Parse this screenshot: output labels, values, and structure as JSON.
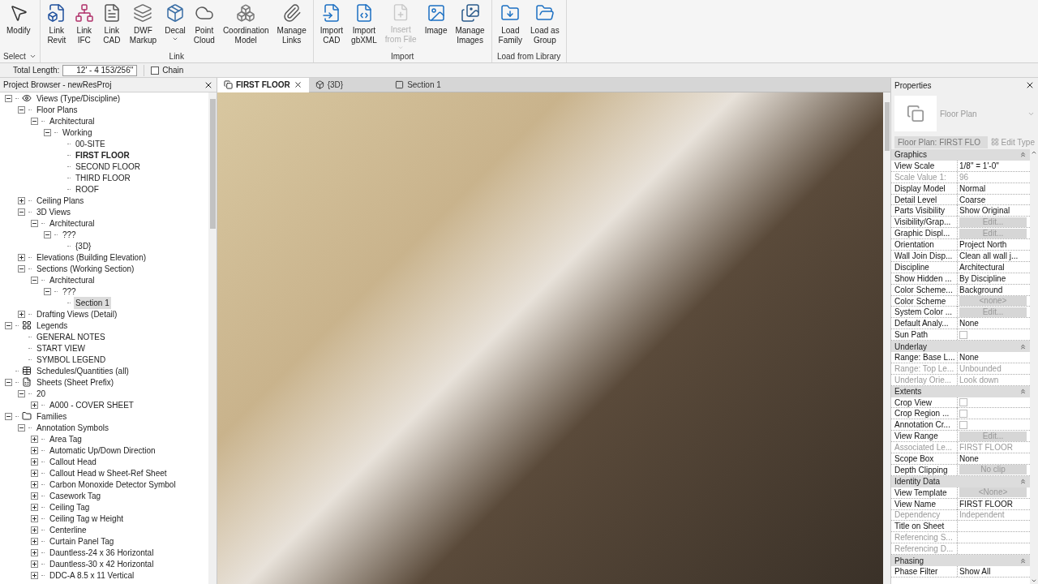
{
  "ribbon": {
    "groups": [
      {
        "label": "Select",
        "dropdown": true,
        "buttons": [
          {
            "lines": [
              "Modify"
            ],
            "disabled": false,
            "dropdown": false
          }
        ]
      },
      {
        "label": "Link",
        "dropdown": false,
        "buttons": [
          {
            "lines": [
              "Link",
              "Revit"
            ],
            "disabled": false,
            "dropdown": false
          },
          {
            "lines": [
              "Link",
              "IFC"
            ],
            "disabled": false,
            "dropdown": false
          },
          {
            "lines": [
              "Link",
              "CAD"
            ],
            "disabled": false,
            "dropdown": false
          },
          {
            "lines": [
              "DWF",
              "Markup"
            ],
            "disabled": false,
            "dropdown": false
          },
          {
            "lines": [
              "Decal"
            ],
            "disabled": false,
            "dropdown": true
          },
          {
            "lines": [
              "Point",
              "Cloud"
            ],
            "disabled": false,
            "dropdown": false
          },
          {
            "lines": [
              "Coordination",
              "Model"
            ],
            "disabled": false,
            "dropdown": false
          },
          {
            "lines": [
              "Manage",
              "Links"
            ],
            "disabled": false,
            "dropdown": false
          }
        ]
      },
      {
        "label": "Import",
        "dropdown": false,
        "buttons": [
          {
            "lines": [
              "Import",
              "CAD"
            ],
            "disabled": false,
            "dropdown": false
          },
          {
            "lines": [
              "Import",
              "gbXML"
            ],
            "disabled": false,
            "dropdown": false
          },
          {
            "lines": [
              "Insert",
              "from File"
            ],
            "disabled": true,
            "dropdown": true
          },
          {
            "lines": [
              "Image"
            ],
            "disabled": false,
            "dropdown": false
          },
          {
            "lines": [
              "Manage",
              "Images"
            ],
            "disabled": false,
            "dropdown": false
          }
        ]
      },
      {
        "label": "Load from Library",
        "dropdown": false,
        "buttons": [
          {
            "lines": [
              "Load",
              "Family"
            ],
            "disabled": false,
            "dropdown": false
          },
          {
            "lines": [
              "Load as",
              "Group"
            ],
            "disabled": false,
            "dropdown": false
          }
        ]
      }
    ]
  },
  "options_bar": {
    "length_label": "Total Length:",
    "length_value": "12' - 4 153/256\"",
    "chain": {
      "label": "Chain",
      "checked": false
    }
  },
  "project_browser": {
    "title": "Project Browser - newResProj",
    "tree": [
      {
        "label": "Views (Type/Discipline)",
        "kind": "views",
        "expanded": true,
        "selected": false,
        "children": [
          {
            "label": "Floor Plans",
            "expanded": true,
            "selected": false,
            "children": [
              {
                "label": "Architectural",
                "expanded": true,
                "selected": false,
                "children": [
                  {
                    "label": "Working",
                    "expanded": true,
                    "selected": false,
                    "children": [
                      {
                        "label": "00-SITE",
                        "selected": false
                      },
                      {
                        "label": "FIRST FLOOR",
                        "selected": false,
                        "bold": true
                      },
                      {
                        "label": "SECOND FLOOR",
                        "selected": false
                      },
                      {
                        "label": "THIRD FLOOR",
                        "selected": false
                      },
                      {
                        "label": "ROOF",
                        "selected": false
                      }
                    ]
                  }
                ]
              }
            ]
          },
          {
            "label": "Ceiling Plans",
            "expanded": false,
            "selected": false
          },
          {
            "label": "3D Views",
            "expanded": true,
            "selected": false,
            "children": [
              {
                "label": "Architectural",
                "expanded": true,
                "selected": false,
                "children": [
                  {
                    "label": "???",
                    "expanded": true,
                    "selected": false,
                    "children": [
                      {
                        "label": "{3D}",
                        "selected": false
                      }
                    ]
                  }
                ]
              }
            ]
          },
          {
            "label": "Elevations (Building Elevation)",
            "expanded": false,
            "selected": false
          },
          {
            "label": "Sections (Working Section)",
            "expanded": true,
            "selected": false,
            "children": [
              {
                "label": "Architectural",
                "expanded": true,
                "selected": false,
                "children": [
                  {
                    "label": "???",
                    "expanded": true,
                    "selected": false,
                    "children": [
                      {
                        "label": "Section 1",
                        "selected": true
                      }
                    ]
                  }
                ]
              }
            ]
          },
          {
            "label": "Drafting Views (Detail)",
            "expanded": false,
            "selected": false
          }
        ]
      },
      {
        "label": "Legends",
        "kind": "legends",
        "expanded": true,
        "selected": false,
        "children": [
          {
            "label": "GENERAL NOTES",
            "selected": false
          },
          {
            "label": "START VIEW",
            "selected": false
          },
          {
            "label": "SYMBOL LEGEND",
            "selected": false
          }
        ]
      },
      {
        "label": "Schedules/Quantities (all)",
        "kind": "schedules",
        "selected": false
      },
      {
        "label": "Sheets (Sheet Prefix)",
        "kind": "sheets",
        "expanded": true,
        "selected": false,
        "children": [
          {
            "label": "20",
            "expanded": true,
            "selected": false,
            "children": [
              {
                "label": "A000 - COVER SHEET",
                "expanded": false,
                "selected": false
              }
            ]
          }
        ]
      },
      {
        "label": "Families",
        "kind": "families",
        "expanded": true,
        "selected": false,
        "children": [
          {
            "label": "Annotation Symbols",
            "expanded": true,
            "selected": false,
            "children": [
              {
                "label": "Area Tag",
                "expanded": false,
                "selected": false
              },
              {
                "label": "Automatic Up/Down Direction",
                "expanded": false,
                "selected": false
              },
              {
                "label": "Callout Head",
                "expanded": false,
                "selected": false
              },
              {
                "label": "Callout Head w Sheet-Ref Sheet",
                "expanded": false,
                "selected": false
              },
              {
                "label": "Carbon Monoxide Detector Symbol",
                "expanded": false,
                "selected": false
              },
              {
                "label": "Casework Tag",
                "expanded": false,
                "selected": false
              },
              {
                "label": "Ceiling Tag",
                "expanded": false,
                "selected": false
              },
              {
                "label": "Ceiling Tag w Height",
                "expanded": false,
                "selected": false
              },
              {
                "label": "Centerline",
                "expanded": false,
                "selected": false
              },
              {
                "label": "Curtain Panel Tag",
                "expanded": false,
                "selected": false
              },
              {
                "label": "Dauntless-24 x 36 Horizontal",
                "expanded": false,
                "selected": false
              },
              {
                "label": "Dauntless-30 x 42 Horizontal",
                "expanded": false,
                "selected": false
              },
              {
                "label": "DDC-A 8.5 x 11 Vertical",
                "expanded": false,
                "selected": false
              }
            ]
          }
        ]
      }
    ]
  },
  "view_tabs": [
    {
      "label": "FIRST FLOOR",
      "kind": "plan",
      "selected": true
    },
    {
      "label": "{3D}",
      "kind": "model",
      "selected": false
    },
    {
      "label": "Section 1",
      "kind": "section",
      "selected": false
    }
  ],
  "properties": {
    "title": "Properties",
    "type_name": "Floor Plan",
    "instance_selector": "Floor Plan: FIRST FLO",
    "edit_type": "Edit Type",
    "sections": [
      {
        "title": "Graphics",
        "rows": [
          {
            "label": "View Scale",
            "kind": "text",
            "value": "1/8\" = 1'-0\"",
            "disabled": false
          },
          {
            "label": "Scale Value    1:",
            "kind": "text",
            "value": "96",
            "disabled": true
          },
          {
            "label": "Display Model",
            "kind": "text",
            "value": "Normal",
            "disabled": false
          },
          {
            "label": "Detail Level",
            "kind": "text",
            "value": "Coarse",
            "disabled": false
          },
          {
            "label": "Parts Visibility",
            "kind": "text",
            "value": "Show Original",
            "disabled": false
          },
          {
            "label": "Visibility/Grap...",
            "kind": "button",
            "value": "Edit...",
            "disabled": false
          },
          {
            "label": "Graphic Displ...",
            "kind": "button",
            "value": "Edit...",
            "disabled": false
          },
          {
            "label": "Orientation",
            "kind": "text",
            "value": "Project North",
            "disabled": false
          },
          {
            "label": "Wall Join Disp...",
            "kind": "text",
            "value": "Clean all wall j...",
            "disabled": false
          },
          {
            "label": "Discipline",
            "kind": "text",
            "value": "Architectural",
            "disabled": false
          },
          {
            "label": "Show Hidden ...",
            "kind": "text",
            "value": "By Discipline",
            "disabled": false
          },
          {
            "label": "Color Scheme...",
            "kind": "text",
            "value": "Background",
            "disabled": false
          },
          {
            "label": "Color Scheme",
            "kind": "button",
            "value": "<none>",
            "disabled": false
          },
          {
            "label": "System Color ...",
            "kind": "button",
            "value": "Edit...",
            "disabled": false
          },
          {
            "label": "Default Analy...",
            "kind": "text",
            "value": "None",
            "disabled": false
          },
          {
            "label": "Sun Path",
            "kind": "checkbox",
            "checked": false,
            "disabled": false
          }
        ]
      },
      {
        "title": "Underlay",
        "rows": [
          {
            "label": "Range: Base L...",
            "kind": "text",
            "value": "None",
            "disabled": false
          },
          {
            "label": "Range: Top Le...",
            "kind": "text",
            "value": "Unbounded",
            "disabled": true
          },
          {
            "label": "Underlay Orie...",
            "kind": "text",
            "value": "Look down",
            "disabled": true
          }
        ]
      },
      {
        "title": "Extents",
        "rows": [
          {
            "label": "Crop View",
            "kind": "checkbox",
            "checked": false,
            "disabled": false
          },
          {
            "label": "Crop Region ...",
            "kind": "checkbox",
            "checked": false,
            "disabled": false
          },
          {
            "label": "Annotation Cr...",
            "kind": "checkbox",
            "checked": false,
            "disabled": false
          },
          {
            "label": "View Range",
            "kind": "button",
            "value": "Edit...",
            "disabled": false
          },
          {
            "label": "Associated Le...",
            "kind": "text",
            "value": "FIRST FLOOR",
            "disabled": true
          },
          {
            "label": "Scope Box",
            "kind": "text",
            "value": "None",
            "disabled": false
          },
          {
            "label": "Depth Clipping",
            "kind": "button",
            "value": "No clip",
            "disabled": false
          }
        ]
      },
      {
        "title": "Identity Data",
        "rows": [
          {
            "label": "View Template",
            "kind": "button",
            "value": "<None>",
            "disabled": false
          },
          {
            "label": "View Name",
            "kind": "text",
            "value": "FIRST FLOOR",
            "disabled": false
          },
          {
            "label": "Dependency",
            "kind": "text",
            "value": "Independent",
            "disabled": true
          },
          {
            "label": "Title on Sheet",
            "kind": "text",
            "disabled": false
          },
          {
            "label": "Referencing S...",
            "kind": "text",
            "disabled": true
          },
          {
            "label": "Referencing D...",
            "kind": "text",
            "disabled": true
          }
        ]
      },
      {
        "title": "Phasing",
        "rows": [
          {
            "label": "Phase Filter",
            "kind": "text",
            "value": "Show All",
            "disabled": false
          }
        ]
      }
    ]
  }
}
